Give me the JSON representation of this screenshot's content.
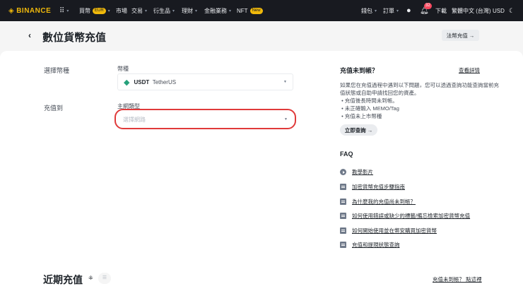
{
  "nav": {
    "logo": "BINANCE",
    "items": [
      {
        "label": "買幣",
        "badge": "EUR"
      },
      {
        "label": "市場"
      },
      {
        "label": "交易"
      },
      {
        "label": "衍生品"
      },
      {
        "label": "理財"
      },
      {
        "label": "金融業務"
      },
      {
        "label": "NFT",
        "badge": "New"
      }
    ],
    "right": {
      "wallet": "錢包",
      "orders": "訂單",
      "notifications": "32",
      "download": "下載",
      "language": "繁體中文 (台灣)",
      "currency": "USD"
    }
  },
  "header": {
    "title": "數位貨幣充值",
    "fiat_button": "法幣充值 →"
  },
  "form": {
    "select_coin_label": "選擇幣種",
    "coin_field_label": "幣種",
    "coin_symbol": "USDT",
    "coin_name": "TetherUS",
    "deposit_to_label": "充值到",
    "network_field_label": "主網類型",
    "network_placeholder": "選擇網路",
    "highlight_color": "#e03a3a"
  },
  "help": {
    "title": "充值未到帳？",
    "details_link": "查看詳情",
    "paragraph": "如果您在充值過程中遇到以下問題，您可以透過查詢功能查詢當前充值狀態或自助申請找回您的資產。",
    "bullets": [
      "充值後長時間未到帳。",
      "未正確輸入 MEMO/Tag",
      "充值未上市幣種"
    ],
    "query_button": "立即查詢 →"
  },
  "faq": {
    "title": "FAQ",
    "items": [
      {
        "icon": "play-icon",
        "label": "教學影片"
      },
      {
        "icon": "document-icon",
        "label": "加密貨幣充值步驟指南"
      },
      {
        "icon": "document-icon",
        "label": "為什麼我的充值尚未到帳？"
      },
      {
        "icon": "document-icon",
        "label": "如何使用錯誤或缺少的標籤/備忘檢索加密貨幣充值"
      },
      {
        "icon": "document-icon",
        "label": "如何開始使用並在幣安購買加密貨幣"
      },
      {
        "icon": "document-icon",
        "label": "充值和提現狀態查詢"
      }
    ]
  },
  "recent": {
    "title": "近期充值",
    "help_link": "充值未到帳？ 點這裡"
  }
}
